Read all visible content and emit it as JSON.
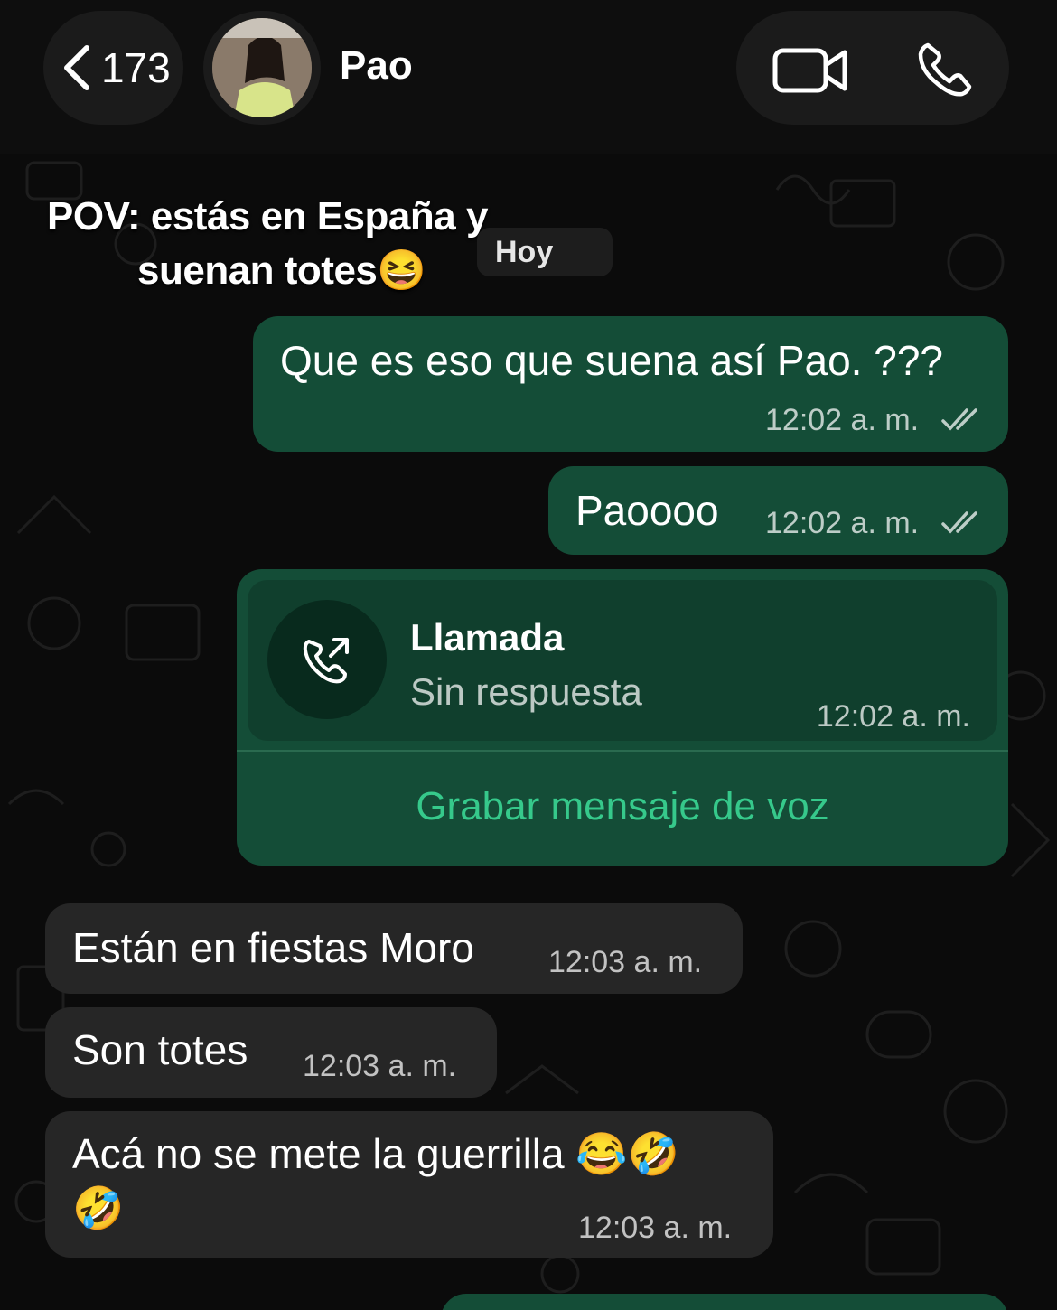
{
  "header": {
    "back_count": "173",
    "contact_name": "Pao"
  },
  "overlay": {
    "caption_line1": "POV: estás en España y",
    "caption_line2": "suenan totes😆"
  },
  "date_chip": "Hoy",
  "messages": [
    {
      "direction": "out",
      "text": "Que es eso que suena así Pao. ???",
      "time": "12:02 a. m.",
      "status": "read"
    },
    {
      "direction": "out",
      "text": "Paoooo",
      "time": "12:02 a. m.",
      "status": "read"
    },
    {
      "direction": "out",
      "type": "call",
      "title": "Llamada",
      "subtitle": "Sin respuesta",
      "time": "12:02 a. m.",
      "action": "Grabar mensaje de voz"
    },
    {
      "direction": "in",
      "text": "Están en fiestas Moro",
      "time": "12:03 a. m."
    },
    {
      "direction": "in",
      "text": "Son totes",
      "time": "12:03 a. m."
    },
    {
      "direction": "in",
      "text": "Acá no se mete la guerrilla 😂🤣",
      "text_line2": "🤣",
      "time": "12:03 a. m."
    }
  ],
  "colors": {
    "outgoing_bubble": "#144d37",
    "incoming_bubble": "#262626",
    "accent_green": "#36c98b",
    "background": "#0b0b0b"
  }
}
